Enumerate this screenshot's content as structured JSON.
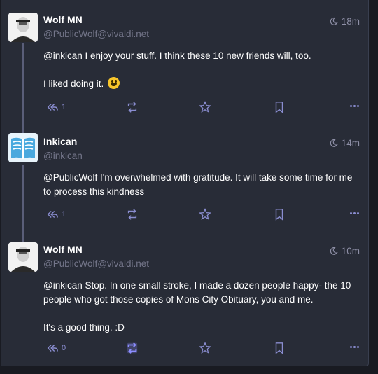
{
  "statuses": [
    {
      "author": "Wolf MN",
      "handle": "@PublicWolf@vivaldi.net",
      "time": "18m",
      "paragraphs": [
        {
          "mention": "@inkican",
          "text": " I enjoy your stuff. I think these 10 new friends will, too."
        },
        {
          "mention": "",
          "text": "I liked doing it."
        }
      ],
      "reply_count": "1"
    },
    {
      "author": "Inkican",
      "handle": "@inkican",
      "time": "14m",
      "paragraphs": [
        {
          "mention": "@PublicWolf",
          "text": " I'm overwhelmed with gratitude. It will take some time for me"
        },
        {
          "mention": "",
          "text": "to process this kindness"
        }
      ],
      "reply_count": "1"
    },
    {
      "author": "Wolf MN",
      "handle": "@PublicWolf@vivaldi.net",
      "time": "10m",
      "paragraphs": [
        {
          "mention": "@inkican",
          "text": " Stop. In one small stroke, I made a dozen people happy- the 10"
        },
        {
          "mention": "",
          "text": "people who got those copies of Mons City Obituary, you and me."
        },
        {
          "mention": "",
          "text": "It's a good thing. :D"
        }
      ],
      "reply_count": "0"
    }
  ],
  "colors": {
    "accent": "#8a8dd0",
    "background": "#282c37",
    "boost_active": "#8c8dff"
  }
}
